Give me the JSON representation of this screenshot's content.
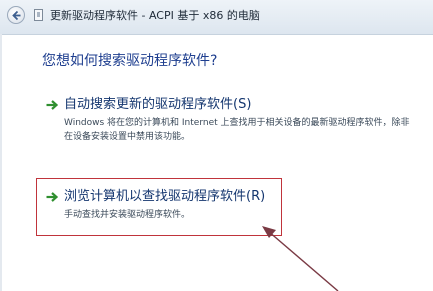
{
  "window": {
    "title": "更新驱动程序软件 - ACPI 基于 x86 的电脑",
    "back_icon": "back-arrow-icon",
    "device_icon": "device-icon"
  },
  "main": {
    "heading": "您想如何搜索驱动程序软件?",
    "options": [
      {
        "title": "自动搜索更新的驱动程序软件(S)",
        "description": "Windows 将在您的计算机和 Internet 上查找用于相关设备的最新驱动程序软件，除非在设备安装设置中禁用该功能。",
        "icon": "green-arrow-icon"
      },
      {
        "title": "浏览计算机以查找驱动程序软件(R)",
        "description": "手动查找并安装驱动程序软件。",
        "icon": "green-arrow-icon"
      }
    ]
  },
  "colors": {
    "heading": "#1e3e8f",
    "option_title": "#14366f",
    "highlight": "#c0343b",
    "arrow_green": "#2f8f2f"
  }
}
